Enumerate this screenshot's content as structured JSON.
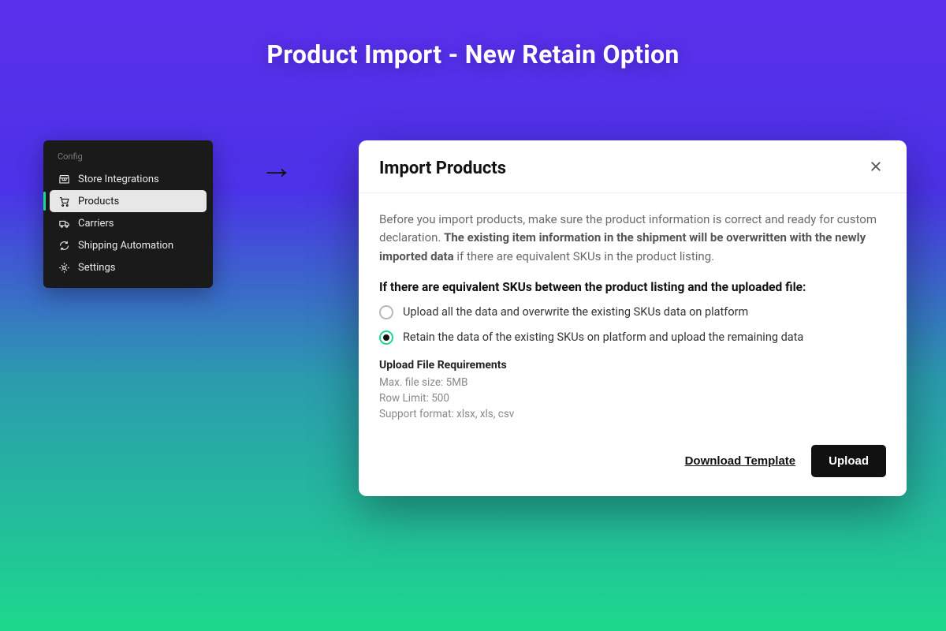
{
  "page_title": "Product Import - New  Retain Option",
  "sidebar": {
    "heading": "Config",
    "items": [
      {
        "label": "Store Integrations",
        "icon": "store-icon",
        "active": false
      },
      {
        "label": "Products",
        "icon": "cart-icon",
        "active": true
      },
      {
        "label": "Carriers",
        "icon": "truck-icon",
        "active": false
      },
      {
        "label": "Shipping Automation",
        "icon": "automation-icon",
        "active": false
      },
      {
        "label": "Settings",
        "icon": "gear-icon",
        "active": false
      }
    ]
  },
  "modal": {
    "title": "Import Products",
    "intro_pre": "Before you import products, make sure the product information is correct and ready for custom declaration. ",
    "intro_bold": "The existing item information in the shipment will be overwritten with the newly imported data",
    "intro_post": " if there are equivalent SKUs in the product listing.",
    "section_heading": "If there are equivalent SKUs between the product listing and the uploaded file:",
    "options": [
      {
        "label": "Upload all the data and overwrite the existing SKUs data on platform",
        "selected": false
      },
      {
        "label": "Retain the data of the existing SKUs on platform and upload the remaining data",
        "selected": true
      }
    ],
    "requirements": {
      "title": "Upload File Requirements",
      "lines": [
        "Max. file size: 5MB",
        "Row Limit: 500",
        "Support format: xlsx, xls, csv"
      ]
    },
    "download_label": "Download Template",
    "upload_label": "Upload"
  }
}
